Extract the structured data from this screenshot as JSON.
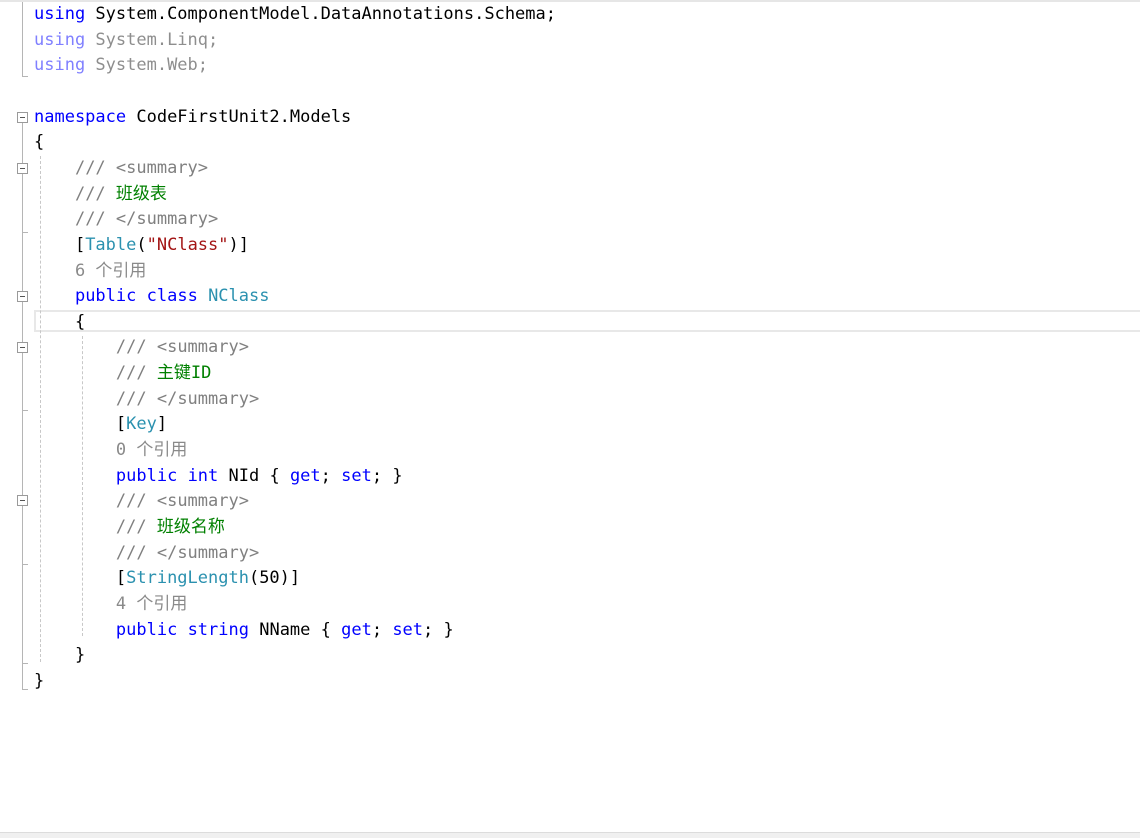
{
  "editor": {
    "lines": [
      [
        {
          "t": "using",
          "c": "kw"
        },
        {
          "t": " System.ComponentModel.DataAnnotations.Schema;",
          "c": ""
        }
      ],
      [
        {
          "t": "using",
          "c": "kwdim"
        },
        {
          "t": " System.Linq;",
          "c": "dim"
        }
      ],
      [
        {
          "t": "using",
          "c": "kwdim"
        },
        {
          "t": " System.Web;",
          "c": "dim"
        }
      ],
      [],
      [
        {
          "t": "namespace",
          "c": "kw"
        },
        {
          "t": " CodeFirstUnit2.Models",
          "c": ""
        }
      ],
      [
        {
          "t": "{",
          "c": ""
        }
      ],
      [
        {
          "t": "    ",
          "c": ""
        },
        {
          "t": "/// ",
          "c": "cmg"
        },
        {
          "t": "<summary>",
          "c": "cmg"
        }
      ],
      [
        {
          "t": "    ",
          "c": ""
        },
        {
          "t": "/// ",
          "c": "cmg"
        },
        {
          "t": "班级表",
          "c": "cm"
        }
      ],
      [
        {
          "t": "    ",
          "c": ""
        },
        {
          "t": "/// ",
          "c": "cmg"
        },
        {
          "t": "</summary>",
          "c": "cmg"
        }
      ],
      [
        {
          "t": "    [",
          "c": ""
        },
        {
          "t": "Table",
          "c": "ty"
        },
        {
          "t": "(",
          "c": ""
        },
        {
          "t": "\"NClass\"",
          "c": "str"
        },
        {
          "t": ")]",
          "c": ""
        }
      ],
      [
        {
          "t": "    ",
          "c": ""
        },
        {
          "t": "6 个引用",
          "c": "ref"
        }
      ],
      [
        {
          "t": "    ",
          "c": ""
        },
        {
          "t": "public",
          "c": "kw"
        },
        {
          "t": " ",
          "c": ""
        },
        {
          "t": "class",
          "c": "kw"
        },
        {
          "t": " ",
          "c": ""
        },
        {
          "t": "NClass",
          "c": "ty"
        }
      ],
      [
        {
          "t": "    {",
          "c": ""
        }
      ],
      [
        {
          "t": "        ",
          "c": ""
        },
        {
          "t": "/// ",
          "c": "cmg"
        },
        {
          "t": "<summary>",
          "c": "cmg"
        }
      ],
      [
        {
          "t": "        ",
          "c": ""
        },
        {
          "t": "/// ",
          "c": "cmg"
        },
        {
          "t": "主键ID",
          "c": "cm"
        }
      ],
      [
        {
          "t": "        ",
          "c": ""
        },
        {
          "t": "/// ",
          "c": "cmg"
        },
        {
          "t": "</summary>",
          "c": "cmg"
        }
      ],
      [
        {
          "t": "        [",
          "c": ""
        },
        {
          "t": "Key",
          "c": "ty"
        },
        {
          "t": "]",
          "c": ""
        }
      ],
      [
        {
          "t": "        ",
          "c": ""
        },
        {
          "t": "0 个引用",
          "c": "ref"
        }
      ],
      [
        {
          "t": "        ",
          "c": ""
        },
        {
          "t": "public",
          "c": "kw"
        },
        {
          "t": " ",
          "c": ""
        },
        {
          "t": "int",
          "c": "kw"
        },
        {
          "t": " NId { ",
          "c": ""
        },
        {
          "t": "get",
          "c": "kw"
        },
        {
          "t": "; ",
          "c": ""
        },
        {
          "t": "set",
          "c": "kw"
        },
        {
          "t": "; }",
          "c": ""
        }
      ],
      [
        {
          "t": "        ",
          "c": ""
        },
        {
          "t": "/// ",
          "c": "cmg"
        },
        {
          "t": "<summary>",
          "c": "cmg"
        }
      ],
      [
        {
          "t": "        ",
          "c": ""
        },
        {
          "t": "/// ",
          "c": "cmg"
        },
        {
          "t": "班级名称",
          "c": "cm"
        }
      ],
      [
        {
          "t": "        ",
          "c": ""
        },
        {
          "t": "/// ",
          "c": "cmg"
        },
        {
          "t": "</summary>",
          "c": "cmg"
        }
      ],
      [
        {
          "t": "        [",
          "c": ""
        },
        {
          "t": "StringLength",
          "c": "ty"
        },
        {
          "t": "(50)]",
          "c": ""
        }
      ],
      [
        {
          "t": "        ",
          "c": ""
        },
        {
          "t": "4 个引用",
          "c": "ref"
        }
      ],
      [
        {
          "t": "        ",
          "c": ""
        },
        {
          "t": "public",
          "c": "kw"
        },
        {
          "t": " ",
          "c": ""
        },
        {
          "t": "string",
          "c": "kw"
        },
        {
          "t": " NName { ",
          "c": ""
        },
        {
          "t": "get",
          "c": "kw"
        },
        {
          "t": "; ",
          "c": ""
        },
        {
          "t": "set",
          "c": "kw"
        },
        {
          "t": "; }",
          "c": ""
        }
      ],
      [
        {
          "t": "    }",
          "c": ""
        }
      ],
      [
        {
          "t": "}",
          "c": ""
        }
      ]
    ],
    "fold_markers": [
      "namespace-fold",
      "summary-fold",
      "class-fold",
      "summary-fold",
      "summary-fold"
    ],
    "colors": {
      "keyword": "#0000ff",
      "type": "#2b91af",
      "comment": "#008000",
      "doc_tag": "#808080",
      "string": "#a31515",
      "codelens": "#8a8a8a"
    }
  }
}
